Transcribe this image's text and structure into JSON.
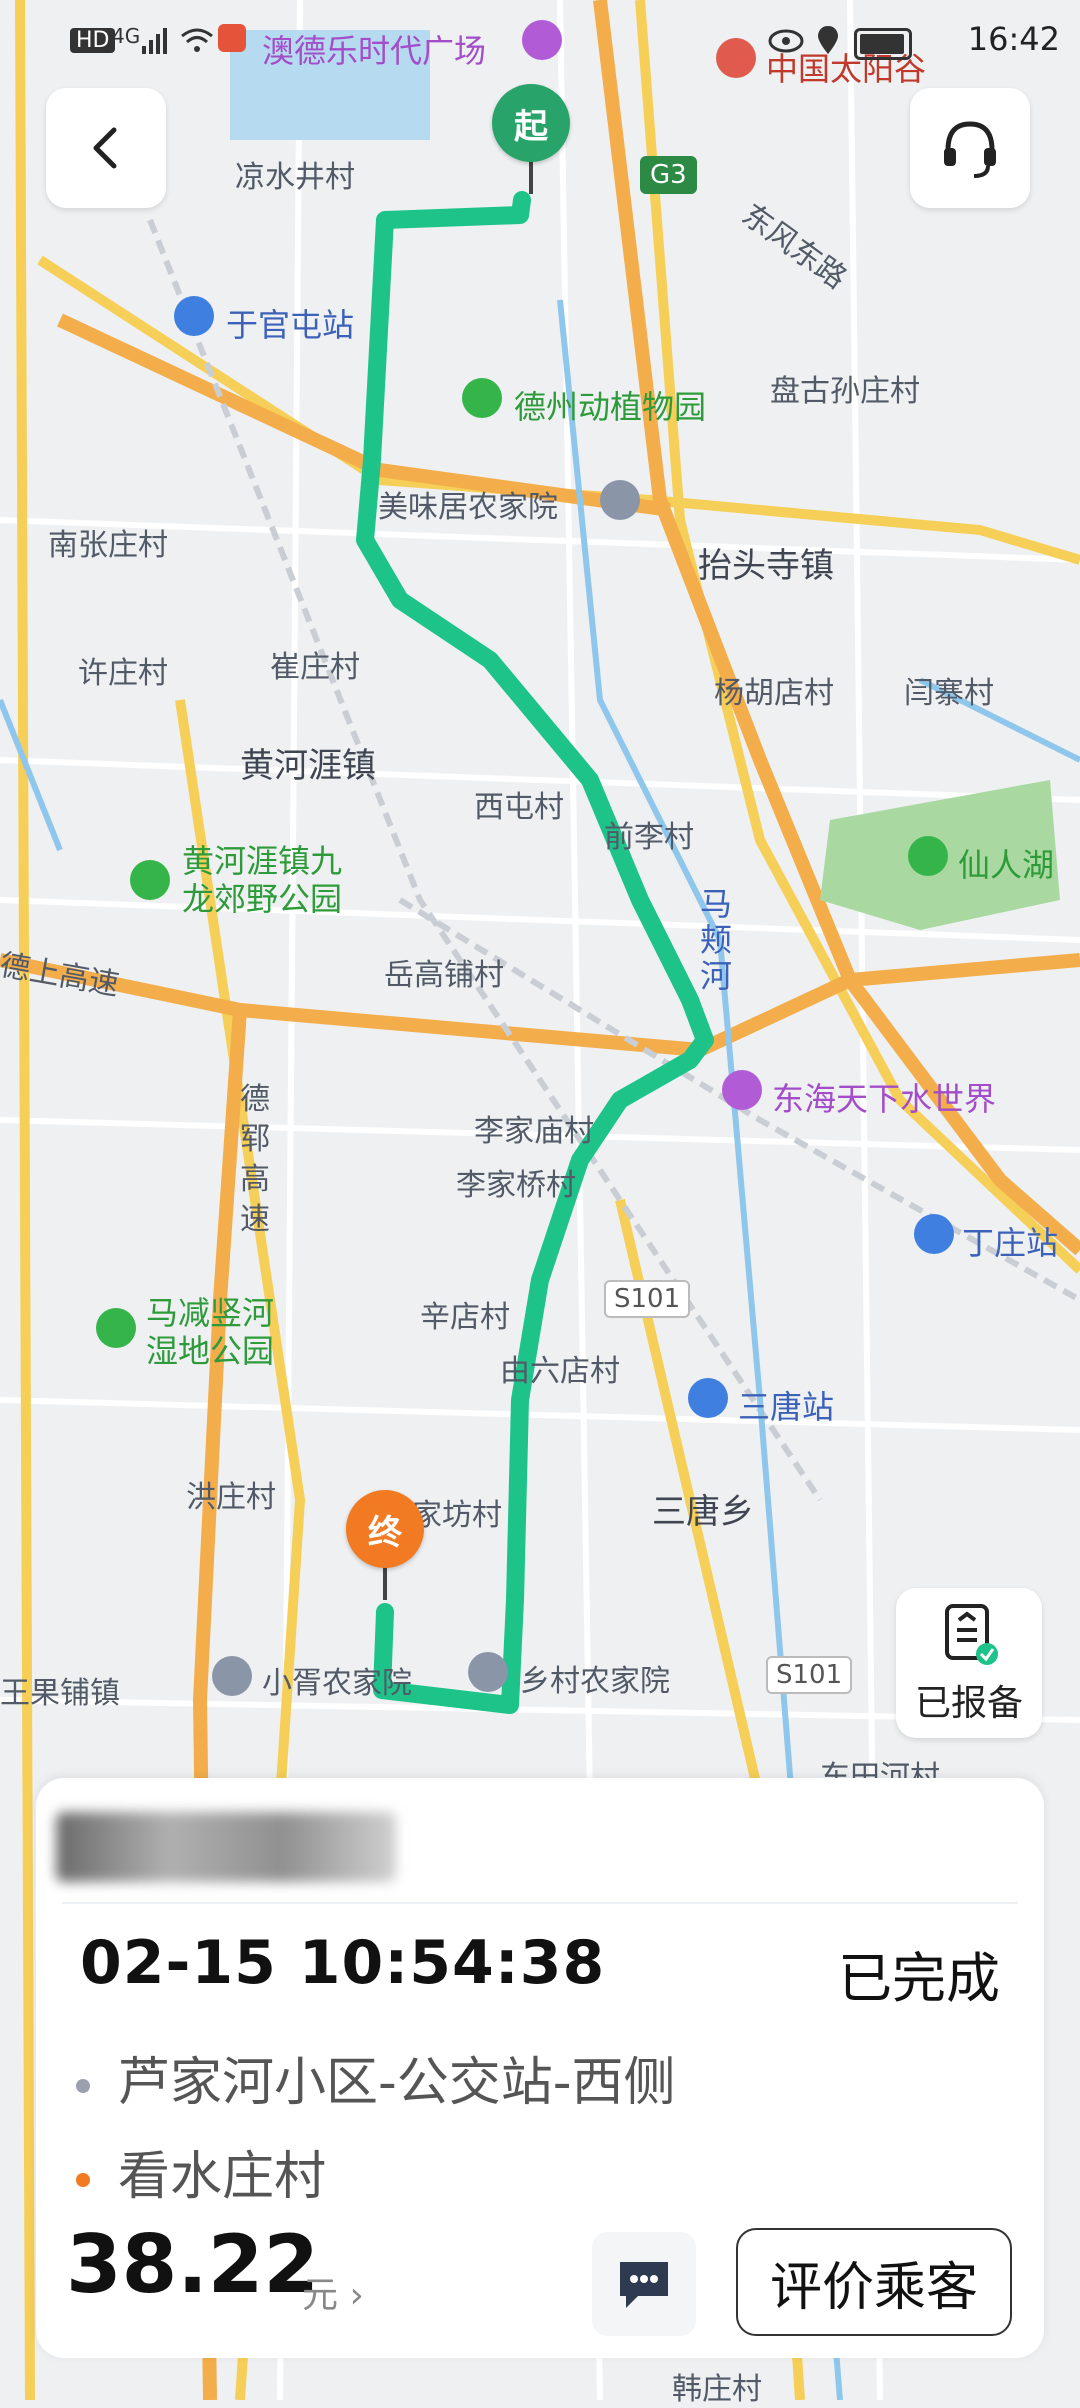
{
  "status_bar": {
    "time": "16:42",
    "network": "4G"
  },
  "map": {
    "labels": [
      {
        "name": "liangshuijing",
        "text": "凉水井村"
      },
      {
        "name": "yuguantun",
        "text": "于官屯站"
      },
      {
        "name": "nanzhang",
        "text": "南张庄村"
      },
      {
        "name": "xuzhuang",
        "text": "许庄村"
      },
      {
        "name": "cuizhuang",
        "text": "崔庄村"
      },
      {
        "name": "huangheyazhen",
        "text": "黄河涯镇"
      },
      {
        "name": "xitun",
        "text": "西屯村"
      },
      {
        "name": "qianli",
        "text": "前李村"
      },
      {
        "name": "taitousi",
        "text": "抬头寺镇"
      },
      {
        "name": "yanghudian",
        "text": "杨胡店村"
      },
      {
        "name": "yanzhai",
        "text": "闫寨村"
      },
      {
        "name": "pangusun",
        "text": "盘古孙庄村"
      },
      {
        "name": "dongfeng",
        "text": "东风东路"
      },
      {
        "name": "yuegaopu",
        "text": "岳高铺村"
      },
      {
        "name": "dezhou_shang",
        "text": "德上高速"
      },
      {
        "name": "lijiamiao",
        "text": "李家庙村"
      },
      {
        "name": "lijiaqiao",
        "text": "李家桥村"
      },
      {
        "name": "xindian",
        "text": "辛店村"
      },
      {
        "name": "youliudian",
        "text": "由六店村"
      },
      {
        "name": "hongzhuang",
        "text": "洪庄村"
      },
      {
        "name": "sanyangxiang",
        "text": "三唐乡"
      },
      {
        "name": "dingzhuang",
        "text": "丁庄站"
      },
      {
        "name": "santang",
        "text": "三唐站"
      },
      {
        "name": "wangguopu",
        "text": "王果铺镇"
      },
      {
        "name": "xiaoxu",
        "text": "小胥农家院"
      },
      {
        "name": "xiangcun",
        "text": "乡村农家院"
      },
      {
        "name": "meiweiju",
        "text": "美味居农家院"
      },
      {
        "name": "dongtianhe",
        "text": "东田河村"
      },
      {
        "name": "hanzhuang",
        "text": "韩庄村"
      },
      {
        "name": "zhujiafang",
        "text": "家坊村"
      },
      {
        "name": "maxiahe",
        "text": "马颊河"
      },
      {
        "name": "dunyun",
        "text": "德郓高速"
      }
    ],
    "pois": [
      {
        "name": "aodele",
        "text": "澳德乐时代广场",
        "color": "#a34ec8"
      },
      {
        "name": "zhongguotaiyanggu",
        "text": "中国太阳谷",
        "color": "#c0392b"
      },
      {
        "name": "dezhou_zoo",
        "text": "德州动植物园",
        "color": "#2e9b3a"
      },
      {
        "name": "xianrenhu",
        "text": "仙人湖",
        "color": "#2e9b3a"
      },
      {
        "name": "huanghe_park",
        "text": "黄河涯镇九龙郊野公园",
        "color": "#2e9b3a"
      },
      {
        "name": "donghai",
        "text": "东海天下水世界",
        "color": "#a34ec8"
      },
      {
        "name": "majian",
        "text": "马减竖河湿地公园",
        "color": "#2e9b3a"
      }
    ],
    "road_labels": [
      "G3",
      "S101",
      "S101"
    ],
    "route_color": "#1ec38a",
    "start_label": "起",
    "end_label": "终"
  },
  "reported": {
    "label": "已报备"
  },
  "card": {
    "datetime": "02-15 10:54:38",
    "status": "已完成",
    "from": "芦家河小区-公交站-西侧",
    "to": "看水庄村",
    "fare": "38.22",
    "fare_unit": "元 ›",
    "rate_label": "评价乘客",
    "from_dot_color": "#9aa0ae",
    "to_dot_color": "#f27a22"
  }
}
